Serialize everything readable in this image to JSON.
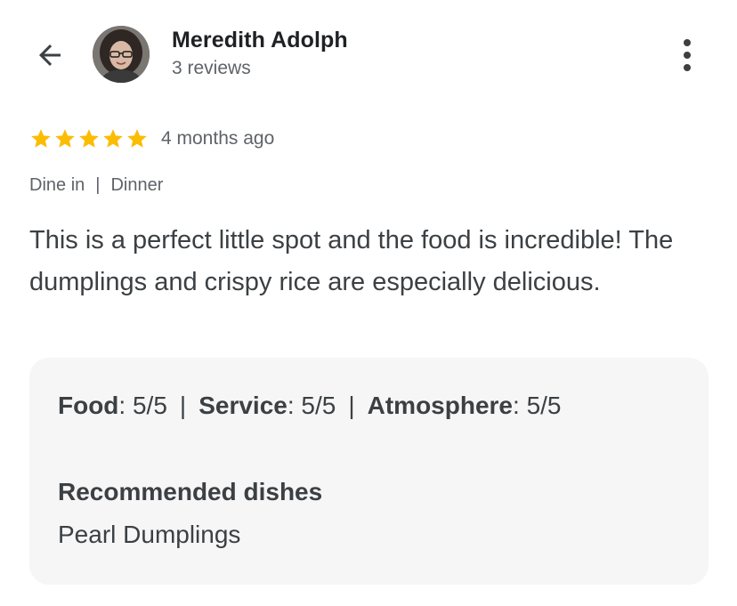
{
  "header": {
    "back_icon": "arrow-left-icon",
    "reviewer_name": "Meredith Adolph",
    "review_count": "3 reviews",
    "more_icon": "more-vertical-icon"
  },
  "rating": {
    "stars": 5,
    "max_stars": 5,
    "star_color": "#fbbc04",
    "time": "4 months ago"
  },
  "meta": {
    "service_type": "Dine in",
    "separator": "|",
    "meal_type": "Dinner"
  },
  "review": {
    "text": "This is a perfect little spot and the food is incredible! The dumplings and crispy rice are especially delicious."
  },
  "details": {
    "aspects": [
      {
        "label": "Food",
        "value": "5/5"
      },
      {
        "label": "Service",
        "value": "5/5"
      },
      {
        "label": "Atmosphere",
        "value": "5/5"
      }
    ],
    "separator": "|",
    "recommended_title": "Recommended dishes",
    "recommended_dish": "Pearl Dumplings"
  },
  "colors": {
    "card_background": "#f6f6f7",
    "text_primary": "#202124",
    "text_secondary": "#5f6368"
  }
}
